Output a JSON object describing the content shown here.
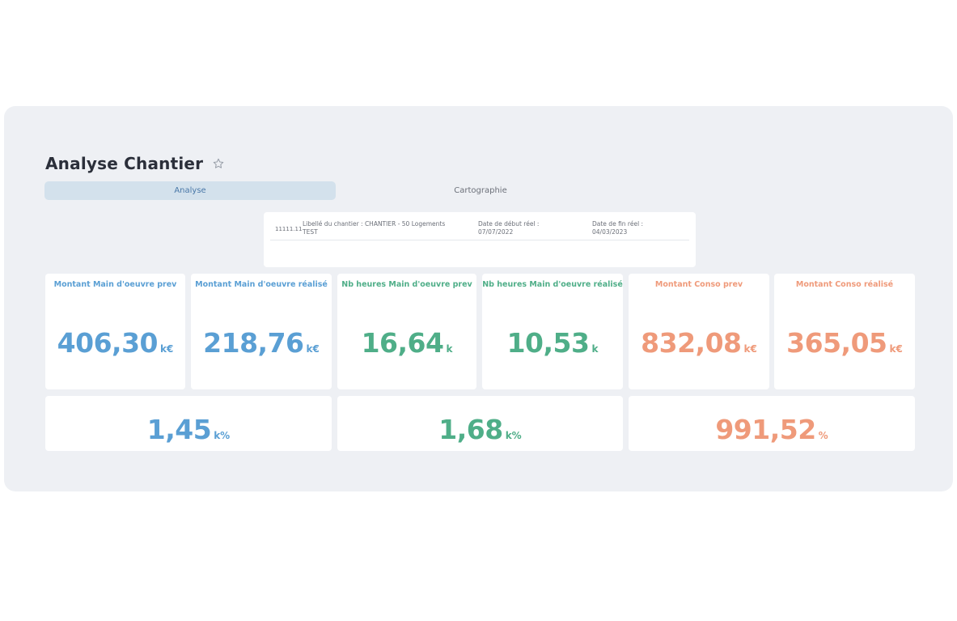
{
  "header": {
    "title": "Analyse Chantier",
    "favorite_icon": "star-outline-icon"
  },
  "tabs": [
    {
      "label": "Analyse",
      "active": true
    },
    {
      "label": "Cartographie",
      "active": false
    }
  ],
  "info": {
    "code": "11111.11",
    "libelle_label": "Libellé du chantier : CHANTIER - 50 Logements",
    "libelle_value": "TEST",
    "date_debut_label": "Date de début réel :",
    "date_debut_value": "07/07/2022",
    "date_fin_label": "Date de fin réel :",
    "date_fin_value": "04/03/2023"
  },
  "colors": {
    "blue": "#5a9fd4",
    "green": "#4fae88",
    "orange": "#ef9a7a",
    "active_tab": "#d3e1ec"
  },
  "kpis": [
    {
      "title": "Montant Main d'oeuvre prev",
      "value": "406,30",
      "unit": "k€"
    },
    {
      "title": "Montant Main d'oeuvre réalisé",
      "value": "218,76",
      "unit": "k€"
    },
    {
      "title": "Nb heures Main d'oeuvre prev",
      "value": "16,64",
      "unit": "k"
    },
    {
      "title": "Nb heures Main d'oeuvre réalisé",
      "value": "10,53",
      "unit": "k"
    },
    {
      "title": "Montant Conso prev",
      "value": "832,08",
      "unit": "k€"
    },
    {
      "title": "Montant Conso réalisé",
      "value": "365,05",
      "unit": "k€"
    }
  ],
  "ratios": [
    {
      "value": "1,45",
      "unit": "k%"
    },
    {
      "value": "1,68",
      "unit": "k%"
    },
    {
      "value": "991,52",
      "unit": "%"
    }
  ]
}
